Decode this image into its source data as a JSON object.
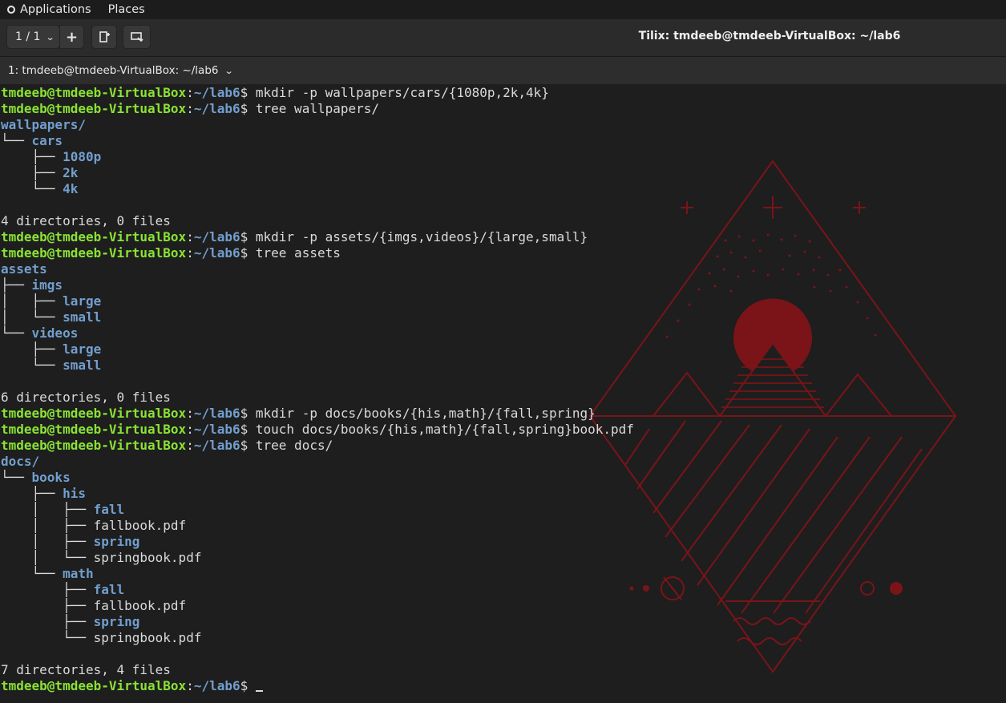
{
  "topbar": {
    "applications_label": "Applications",
    "places_label": "Places"
  },
  "headerbar": {
    "session_label": "1 / 1",
    "window_title": "Tilix: tmdeeb@tmdeeb-VirtualBox: ~/lab6"
  },
  "terminal_title": {
    "label": "1: tmdeeb@tmdeeb-VirtualBox: ~/lab6"
  },
  "terminal": {
    "prompt": {
      "user_host": "tmdeeb@tmdeeb-VirtualBox",
      "colon": ":",
      "path": "~/lab6",
      "symbol": "$ "
    },
    "lines": [
      {
        "type": "prompt",
        "cmd": "mkdir -p wallpapers/cars/{1080p,2k,4k}"
      },
      {
        "type": "prompt",
        "cmd": "tree wallpapers/"
      },
      {
        "type": "tree",
        "prefix": "",
        "name": "wallpapers/",
        "dir": true
      },
      {
        "type": "tree",
        "prefix": "└── ",
        "name": "cars",
        "dir": true
      },
      {
        "type": "tree",
        "prefix": "    ├── ",
        "name": "1080p",
        "dir": true
      },
      {
        "type": "tree",
        "prefix": "    ├── ",
        "name": "2k",
        "dir": true
      },
      {
        "type": "tree",
        "prefix": "    └── ",
        "name": "4k",
        "dir": true
      },
      {
        "type": "text",
        "text": ""
      },
      {
        "type": "text",
        "text": "4 directories, 0 files"
      },
      {
        "type": "prompt",
        "cmd": "mkdir -p assets/{imgs,videos}/{large,small}"
      },
      {
        "type": "prompt",
        "cmd": "tree assets"
      },
      {
        "type": "tree",
        "prefix": "",
        "name": "assets",
        "dir": true
      },
      {
        "type": "tree",
        "prefix": "├── ",
        "name": "imgs",
        "dir": true
      },
      {
        "type": "tree",
        "prefix": "│   ├── ",
        "name": "large",
        "dir": true
      },
      {
        "type": "tree",
        "prefix": "│   └── ",
        "name": "small",
        "dir": true
      },
      {
        "type": "tree",
        "prefix": "└── ",
        "name": "videos",
        "dir": true
      },
      {
        "type": "tree",
        "prefix": "    ├── ",
        "name": "large",
        "dir": true
      },
      {
        "type": "tree",
        "prefix": "    └── ",
        "name": "small",
        "dir": true
      },
      {
        "type": "text",
        "text": ""
      },
      {
        "type": "text",
        "text": "6 directories, 0 files"
      },
      {
        "type": "prompt",
        "cmd": "mkdir -p docs/books/{his,math}/{fall,spring}"
      },
      {
        "type": "prompt",
        "cmd": "touch docs/books/{his,math}/{fall,spring}book.pdf"
      },
      {
        "type": "prompt",
        "cmd": "tree docs/"
      },
      {
        "type": "tree",
        "prefix": "",
        "name": "docs/",
        "dir": true
      },
      {
        "type": "tree",
        "prefix": "└── ",
        "name": "books",
        "dir": true
      },
      {
        "type": "tree",
        "prefix": "    ├── ",
        "name": "his",
        "dir": true
      },
      {
        "type": "tree",
        "prefix": "    │   ├── ",
        "name": "fall",
        "dir": true
      },
      {
        "type": "tree",
        "prefix": "    │   ├── ",
        "name": "fallbook.pdf",
        "dir": false
      },
      {
        "type": "tree",
        "prefix": "    │   ├── ",
        "name": "spring",
        "dir": true
      },
      {
        "type": "tree",
        "prefix": "    │   └── ",
        "name": "springbook.pdf",
        "dir": false
      },
      {
        "type": "tree",
        "prefix": "    └── ",
        "name": "math",
        "dir": true
      },
      {
        "type": "tree",
        "prefix": "        ├── ",
        "name": "fall",
        "dir": true
      },
      {
        "type": "tree",
        "prefix": "        ├── ",
        "name": "fallbook.pdf",
        "dir": false
      },
      {
        "type": "tree",
        "prefix": "        ├── ",
        "name": "spring",
        "dir": true
      },
      {
        "type": "tree",
        "prefix": "        └── ",
        "name": "springbook.pdf",
        "dir": false
      },
      {
        "type": "text",
        "text": ""
      },
      {
        "type": "text",
        "text": "7 directories, 4 files"
      },
      {
        "type": "prompt",
        "cmd": "",
        "cursor": true
      }
    ]
  },
  "colors": {
    "prompt_user": "#8ae234",
    "prompt_path": "#729fcf",
    "directory": "#729fcf",
    "text": "#dadada",
    "background": "#1e1e1e",
    "wallpaper_accent": "#7a1418"
  },
  "icons": {
    "activities": "ubuntu-logo-icon",
    "session_dropdown": "chevron-down-icon",
    "add_terminal": "plus-icon",
    "new_session": "add-terminal-icon",
    "sync_input": "broadcast-input-icon",
    "terminal_menu": "chevron-down-icon"
  }
}
